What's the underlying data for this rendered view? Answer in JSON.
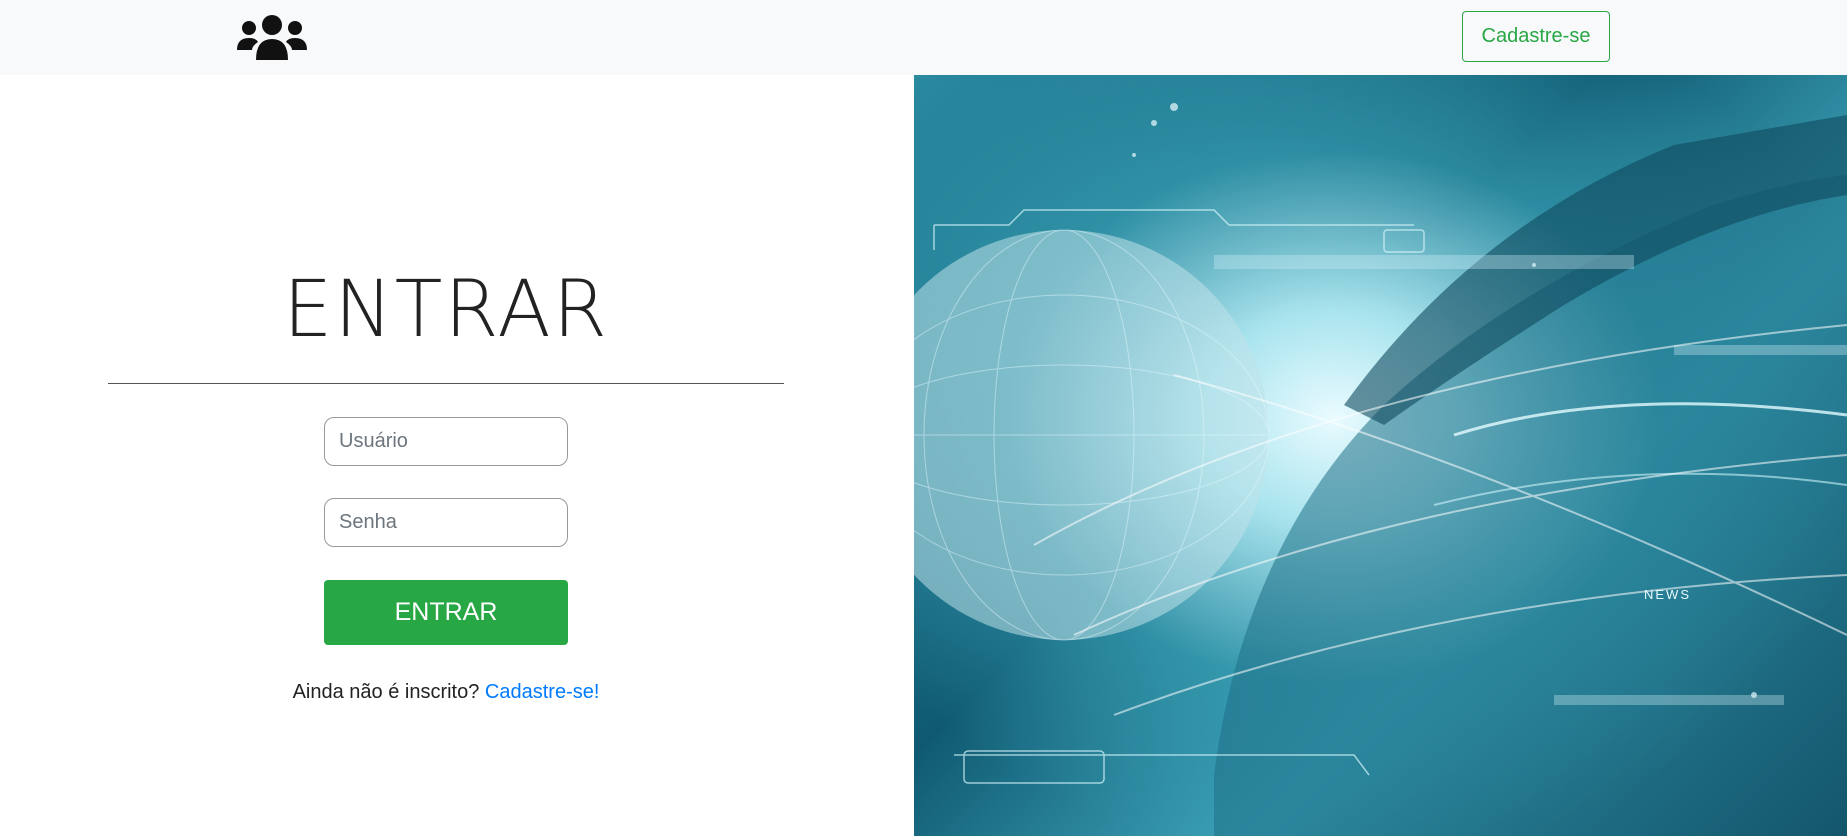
{
  "header": {
    "brand_icon": "users-icon",
    "signup_button_label": "Cadastre-se"
  },
  "login": {
    "title": "ENTRAR",
    "username_placeholder": "Usuário",
    "password_placeholder": "Senha",
    "submit_label": "ENTRAR",
    "signup_prompt": "Ainda não é inscrito?",
    "signup_link": "Cadastre-se!"
  },
  "hero": {
    "news_label": "NEWS"
  },
  "colors": {
    "accent_green": "#28a745",
    "link_blue": "#007bff",
    "navbar_bg": "#f8f9fa"
  }
}
